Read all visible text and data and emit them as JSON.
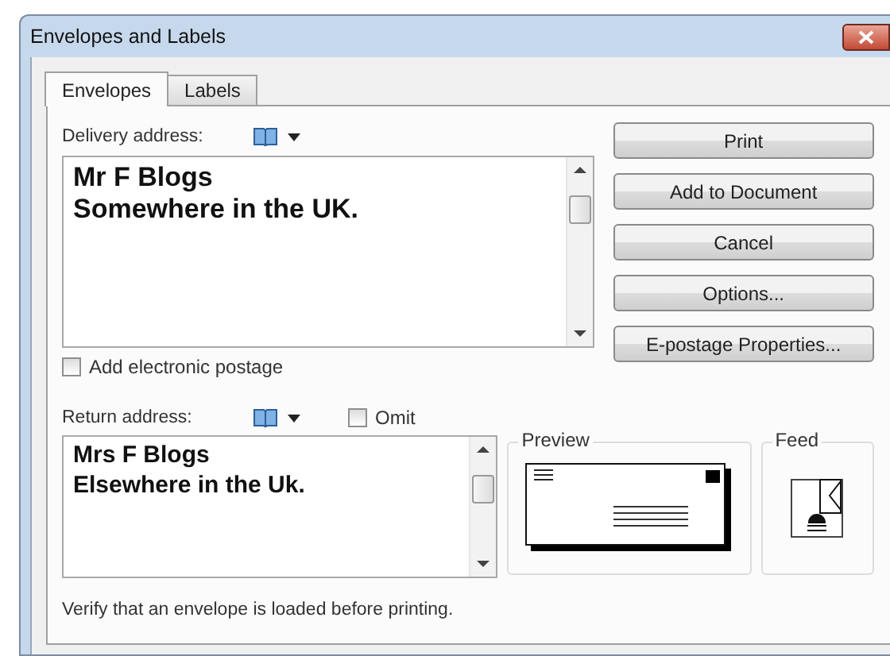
{
  "window": {
    "title": "Envelopes and Labels"
  },
  "tabs": [
    {
      "label": "Envelopes",
      "selected": true
    },
    {
      "label": "Labels",
      "selected": false
    }
  ],
  "delivery": {
    "label": "Delivery address:",
    "lines": [
      "Mr F Blogs",
      "Somewhere in the UK."
    ]
  },
  "electronic_postage": {
    "label": "Add electronic postage",
    "checked": false
  },
  "buttons": [
    "Print",
    "Add to Document",
    "Cancel",
    "Options...",
    "E-postage Properties..."
  ],
  "return_address": {
    "label": "Return address:",
    "lines": [
      "Mrs F Blogs",
      "Elsewhere in the Uk."
    ],
    "omit": {
      "label": "Omit",
      "checked": false
    }
  },
  "preview": {
    "label": "Preview"
  },
  "feed": {
    "label": "Feed"
  },
  "status": "Verify that an envelope is loaded before printing."
}
